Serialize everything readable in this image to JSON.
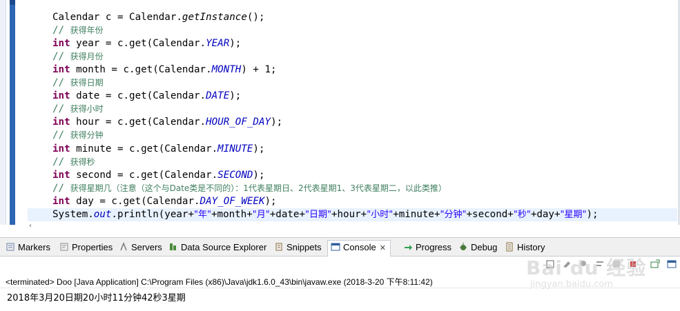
{
  "editor": {
    "lines": [
      {
        "indent": true,
        "parts": [
          [
            "plain",
            "Calendar c = Calendar."
          ],
          [
            "method-it",
            "getInstance"
          ],
          [
            "plain",
            "();"
          ]
        ]
      },
      {
        "indent": true,
        "parts": [
          [
            "cm",
            "// "
          ],
          [
            "cm-cn",
            "获得年份"
          ]
        ]
      },
      {
        "indent": true,
        "parts": [
          [
            "kw",
            "int"
          ],
          [
            "plain",
            " year = c.get(Calendar."
          ],
          [
            "it",
            "YEAR"
          ],
          [
            "plain",
            ");"
          ]
        ]
      },
      {
        "indent": true,
        "parts": [
          [
            "cm",
            "// "
          ],
          [
            "cm-cn",
            "获得月份"
          ]
        ]
      },
      {
        "indent": true,
        "parts": [
          [
            "kw",
            "int"
          ],
          [
            "plain",
            " month = c.get(Calendar."
          ],
          [
            "it",
            "MONTH"
          ],
          [
            "plain",
            ") + 1;"
          ]
        ]
      },
      {
        "indent": true,
        "parts": [
          [
            "cm",
            "// "
          ],
          [
            "cm-cn",
            "获得日期"
          ]
        ]
      },
      {
        "indent": true,
        "parts": [
          [
            "kw",
            "int"
          ],
          [
            "plain",
            " date = c.get(Calendar."
          ],
          [
            "it",
            "DATE"
          ],
          [
            "plain",
            ");"
          ]
        ]
      },
      {
        "indent": true,
        "parts": [
          [
            "cm",
            "// "
          ],
          [
            "cm-cn",
            "获得小时"
          ]
        ]
      },
      {
        "indent": true,
        "parts": [
          [
            "kw",
            "int"
          ],
          [
            "plain",
            " hour = c.get(Calendar."
          ],
          [
            "it",
            "HOUR_OF_DAY"
          ],
          [
            "plain",
            ");"
          ]
        ]
      },
      {
        "indent": true,
        "parts": [
          [
            "cm",
            "// "
          ],
          [
            "cm-cn",
            "获得分钟"
          ]
        ]
      },
      {
        "indent": true,
        "parts": [
          [
            "kw",
            "int"
          ],
          [
            "plain",
            " minute = c.get(Calendar."
          ],
          [
            "it",
            "MINUTE"
          ],
          [
            "plain",
            ");"
          ]
        ]
      },
      {
        "indent": true,
        "parts": [
          [
            "cm",
            "// "
          ],
          [
            "cm-cn",
            "获得秒"
          ]
        ]
      },
      {
        "indent": true,
        "parts": [
          [
            "kw",
            "int"
          ],
          [
            "plain",
            " second = c.get(Calendar."
          ],
          [
            "it",
            "SECOND"
          ],
          [
            "plain",
            ");"
          ]
        ]
      },
      {
        "indent": true,
        "parts": [
          [
            "cm",
            "// "
          ],
          [
            "cm-cn",
            "获得星期几（注意（这个与Date类是不同的）：1代表星期日、2代表星期1、3代表星期二，以此类推）"
          ]
        ]
      },
      {
        "indent": true,
        "parts": [
          [
            "kw",
            "int"
          ],
          [
            "plain",
            " day = c.get(Calendar."
          ],
          [
            "it",
            "DAY_OF_WEEK"
          ],
          [
            "plain",
            ");"
          ]
        ]
      },
      {
        "indent": true,
        "current": true,
        "parts": [
          [
            "plain",
            "System."
          ],
          [
            "it",
            "out"
          ],
          [
            "plain",
            ".println(year+"
          ],
          [
            "str",
            "\"年\""
          ],
          [
            "plain",
            "+month+"
          ],
          [
            "str",
            "\"月\""
          ],
          [
            "plain",
            "+date+"
          ],
          [
            "str",
            "\"日期\""
          ],
          [
            "plain",
            "+hour+"
          ],
          [
            "str",
            "\"小时\""
          ],
          [
            "plain",
            "+minute+"
          ],
          [
            "str",
            "\"分钟\""
          ],
          [
            "plain",
            "+second+"
          ],
          [
            "str",
            "\"秒\""
          ],
          [
            "plain",
            "+day+"
          ],
          [
            "str",
            "\"星期\""
          ],
          [
            "plain",
            ");"
          ]
        ]
      }
    ]
  },
  "tabs": [
    {
      "name": "markers",
      "label": "Markers",
      "icon": "markers-icon",
      "color": "#6b7fa8"
    },
    {
      "name": "properties",
      "label": "Properties",
      "icon": "properties-icon",
      "color": "#8a8a8a"
    },
    {
      "name": "servers",
      "label": "Servers",
      "icon": "servers-icon",
      "color": "#7a7a7a"
    },
    {
      "name": "data-source-explorer",
      "label": "Data Source Explorer",
      "icon": "database-icon",
      "color": "#4b8b3b"
    },
    {
      "name": "snippets",
      "label": "Snippets",
      "icon": "snippets-icon",
      "color": "#8a6d3b"
    },
    {
      "name": "console",
      "label": "Console",
      "icon": "console-icon",
      "color": "#2f5f9e",
      "active": true,
      "close": "✕"
    },
    {
      "name": "progress",
      "label": "Progress",
      "icon": "progress-icon",
      "color": "#2f9e4f"
    },
    {
      "name": "debug",
      "label": "Debug",
      "icon": "debug-icon",
      "color": "#4a7a3a"
    },
    {
      "name": "history",
      "label": "History",
      "icon": "history-icon",
      "color": "#8a6d3b"
    }
  ],
  "console": {
    "header": "<terminated> Doo [Java Application] C:\\Program Files (x86)\\Java\\jdk1.6.0_43\\bin\\javaw.exe (2018-3-20 下午8:11:42)",
    "output": "2018年3月20日期20小时11分钟42秒3星期"
  },
  "watermark": {
    "logo": "Bai du 经验",
    "url": "jingyan.baidu.com"
  },
  "colors": {
    "keyword": "#7f0055",
    "comment": "#3f7f5f",
    "constant": "#0000c0",
    "string": "#2a00ff",
    "current_line": "#e8f2fe",
    "change_bar": "#2f66b3"
  }
}
